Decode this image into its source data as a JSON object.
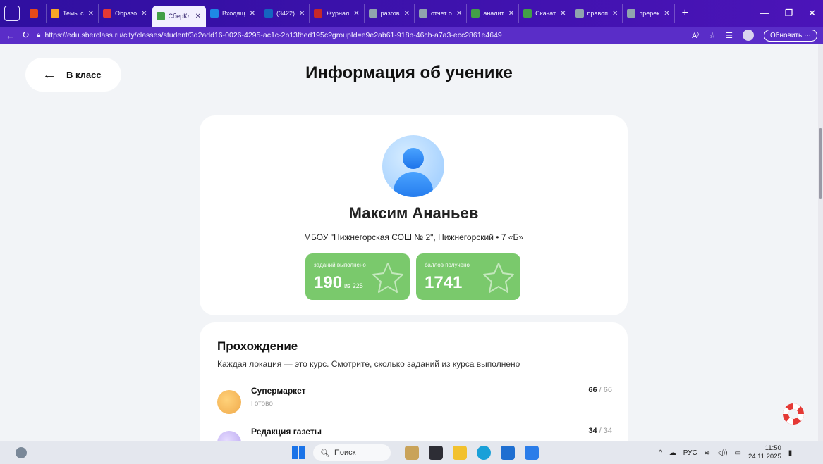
{
  "browser": {
    "tabs": [
      {
        "label": "",
        "color": "#e64a19"
      },
      {
        "label": "Темы с",
        "color": "#f9a825"
      },
      {
        "label": "Образо",
        "color": "#e53935"
      },
      {
        "label": "СберКл",
        "color": "#43a047"
      },
      {
        "label": "Входящ",
        "color": "#1e88e5"
      },
      {
        "label": "(3422)",
        "color": "#1565c0"
      },
      {
        "label": "Журнал",
        "color": "#c62828"
      },
      {
        "label": "разгов",
        "color": "#90a4ae"
      },
      {
        "label": "отчет о",
        "color": "#90a4ae"
      },
      {
        "label": "аналит",
        "color": "#43a047"
      },
      {
        "label": "Скачат",
        "color": "#43a047"
      },
      {
        "label": "правоп",
        "color": "#90a4ae"
      },
      {
        "label": "пререк",
        "color": "#90a4ae"
      }
    ],
    "active_tab": 3,
    "url": "https://edu.sberclass.ru/city/classes/student/3d2add16-0026-4295-ac1c-2b13fbed195c?groupId=e9e2ab61-918b-46cb-a7a3-ecc2861e4649",
    "update_label": "Обновить"
  },
  "page": {
    "back_label": "В класс",
    "title": "Информация об ученике",
    "student": {
      "name": "Максим Ананьев",
      "school": "МБОУ \"Нижнегорская СОШ № 2\", Нижнегорский • 7 «Б»"
    },
    "stats": {
      "tasks_label": "заданий выполнено",
      "tasks_done": "190",
      "tasks_total": "из 225",
      "points_label": "баллов получено",
      "points": "1741"
    },
    "progress": {
      "title": "Прохождение",
      "description": "Каждая локация — это курс. Смотрите, сколько заданий из курса выполнено",
      "courses": [
        {
          "name": "Супермаркет",
          "status": "Готово",
          "done": "66",
          "total": "/ 66"
        },
        {
          "name": "Редакция газеты",
          "status": "",
          "done": "34",
          "total": "/ 34"
        }
      ]
    }
  },
  "taskbar": {
    "search_label": "Поиск",
    "lang": "РУС",
    "time": "11:50",
    "date": "24.11.2025"
  }
}
